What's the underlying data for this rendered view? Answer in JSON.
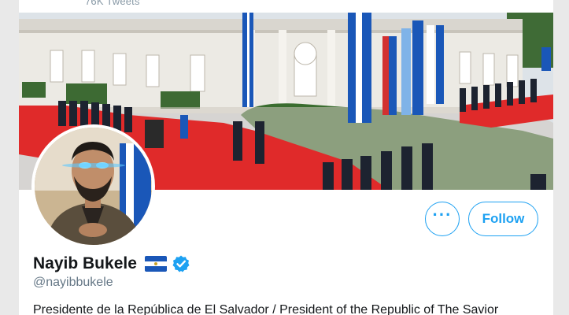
{
  "header": {
    "tweets_count": "76K Tweets"
  },
  "profile": {
    "display_name": "Nayib Bukele",
    "handle": "@nayibbukele",
    "bio": "Presidente de la República de El Salvador / President of the Republic of The Savior",
    "flag_icon": "el-salvador-flag-icon",
    "verified_icon": "verified-badge-icon"
  },
  "actions": {
    "more_label": "···",
    "follow_label": "Follow"
  },
  "colors": {
    "accent": "#1da1f2",
    "text_primary": "#14171a",
    "text_secondary": "#657786",
    "carpet_red": "#e02a2a",
    "flag_blue": "#1a57b8"
  }
}
